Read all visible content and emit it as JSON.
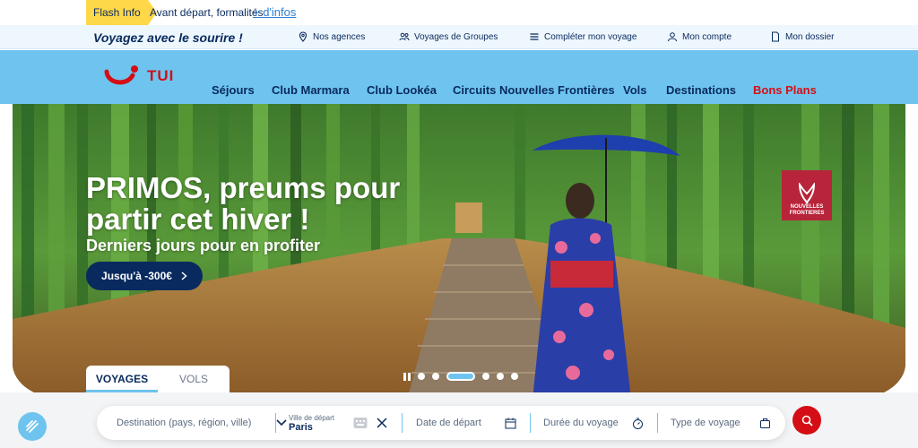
{
  "flash": {
    "tag": "Flash Info",
    "text": "Avant départ, formalités",
    "link": "+ d'infos"
  },
  "subbar": {
    "slogan": "Voyagez avec le sourire !",
    "links": [
      "Nos agences",
      "Voyages de Groupes",
      "Compléter mon voyage",
      "Mon compte",
      "Mon dossier"
    ]
  },
  "nav": {
    "logo": "TUI",
    "items": [
      "Séjours",
      "Club Marmara",
      "Club Lookéa",
      "Circuits Nouvelles Frontières",
      "Vols",
      "Destinations",
      "Bons Plans"
    ]
  },
  "hero": {
    "title": "PRIMOS, preums pour partir cet hiver !",
    "subtitle": "Derniers jours pour en profiter",
    "cta": "Jusqu'à -300€",
    "badge": "NOUVELLES FRONTIERES"
  },
  "tabs": [
    "VOYAGES",
    "VOLS"
  ],
  "search": {
    "destination_placeholder": "Destination (pays, région, ville)",
    "departure_label": "Ville de départ",
    "departure_value": "Paris",
    "date_placeholder": "Date de départ",
    "duration_placeholder": "Durée du voyage",
    "type_placeholder": "Type de voyage"
  },
  "colors": {
    "brand_red": "#d40e14",
    "nav_blue": "#6ec4ef",
    "navy": "#092a5e",
    "flash_yellow": "#ffd84a"
  }
}
